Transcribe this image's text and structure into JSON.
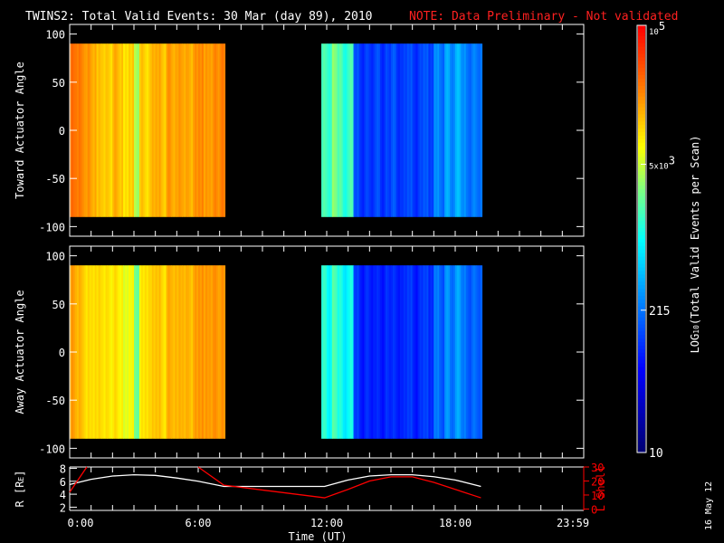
{
  "title": "TWINS2: Total Valid Events: 30 Mar (day  89), 2010",
  "note": "NOTE: Data Preliminary - Not validated",
  "colors": {
    "note": "#ff2020",
    "lshell": "#ff0000",
    "radius": "#ffffff"
  },
  "side_date": "16 May 12",
  "chart_data": [
    {
      "type": "heatmap",
      "title": "Toward Actuator Angle",
      "ylabel": "Toward Actuator Angle",
      "ylim": [
        -110,
        110
      ],
      "yticks": [
        "100",
        "50",
        "0",
        "-50",
        "-100"
      ],
      "angle_range": [
        -90,
        90
      ],
      "time_step_h": 0.25,
      "blocks": [
        {
          "start_h": 0,
          "values_log10": [
            4.5,
            4.45,
            4.35,
            4.3,
            4.2,
            4.15,
            4.1,
            4.05,
            4.2,
            4.1,
            4.0,
            4.1,
            3.6,
            4.1,
            4.0,
            4.2,
            4.25,
            4.1,
            4.3,
            4.2,
            4.3,
            4.25,
            4.2,
            4.3,
            4.35,
            4.3,
            4.3,
            4.35,
            4.4
          ]
        },
        {
          "start_h": 11.75,
          "values_log10": [
            3.3,
            3.2,
            3.5,
            3.3,
            3.1,
            3.3,
            2.2,
            2.0,
            2.1,
            2.0,
            2.2,
            2.0,
            2.1,
            2.2,
            2.0,
            2.1,
            2.2,
            2.0,
            2.1,
            2.2,
            2.1,
            2.5,
            2.3,
            2.6,
            2.4,
            2.7,
            2.5,
            2.3,
            2.4,
            2.3
          ]
        }
      ]
    },
    {
      "type": "heatmap",
      "title": "Away Actuator Angle",
      "ylabel": "Away Actuator Angle",
      "ylim": [
        -110,
        110
      ],
      "yticks": [
        "100",
        "50",
        "0",
        "-50",
        "-100"
      ],
      "angle_range": [
        -90,
        90
      ],
      "time_step_h": 0.25,
      "blocks": [
        {
          "start_h": 0,
          "values_log10": [
            4.3,
            4.2,
            4.1,
            4.0,
            4.0,
            4.05,
            4.0,
            3.95,
            4.0,
            3.9,
            3.8,
            3.9,
            3.4,
            3.95,
            4.0,
            4.1,
            4.15,
            4.0,
            4.2,
            4.15,
            4.2,
            4.2,
            4.15,
            4.25,
            4.3,
            4.3,
            4.3,
            4.3,
            4.3
          ]
        },
        {
          "start_h": 11.75,
          "values_log10": [
            3.2,
            3.0,
            3.3,
            3.1,
            2.9,
            3.1,
            2.1,
            1.9,
            2.0,
            1.9,
            2.0,
            1.9,
            2.0,
            2.0,
            1.9,
            2.0,
            2.1,
            1.9,
            2.0,
            2.1,
            2.0,
            2.4,
            2.2,
            2.5,
            2.3,
            2.6,
            2.4,
            2.2,
            2.3,
            2.2
          ]
        }
      ]
    },
    {
      "type": "line",
      "xlabel": "Time (UT)",
      "xticks": [
        "0:00",
        "6:00",
        "12:00",
        "18:00",
        "23:59"
      ],
      "xlim": [
        0,
        24
      ],
      "ylabel": "R [R_E]",
      "ylabel_parts": {
        "main": "R [R",
        "sub": "E",
        "end": "]"
      },
      "ylim": [
        1.5,
        8.2
      ],
      "yticks": [
        "8",
        "6",
        "4",
        "2"
      ],
      "y2label": "L Shell",
      "y2lim": [
        -1,
        30
      ],
      "y2ticks": [
        "30",
        "20",
        "10",
        "0"
      ],
      "series": [
        {
          "name": "R",
          "color": "#ffffff",
          "x": [
            0,
            1,
            2,
            3,
            4,
            5,
            6,
            7.2,
            11.9,
            13,
            14,
            15,
            16,
            17,
            18,
            19.2
          ],
          "y": [
            5.5,
            6.3,
            6.8,
            7.0,
            6.9,
            6.5,
            6.0,
            5.2,
            5.2,
            6.2,
            6.8,
            7.0,
            7.0,
            6.7,
            6.2,
            5.2
          ]
        },
        {
          "name": "L Shell",
          "color": "#ff0000",
          "segments": [
            {
              "x": [
                0,
                0.8
              ],
              "y": [
                12,
                30
              ]
            },
            {
              "x": [
                6,
                7.2,
                11.9,
                13,
                14,
                15,
                16,
                17,
                18,
                19.2
              ],
              "y": [
                30,
                17,
                8,
                14,
                20,
                23,
                23,
                19,
                14,
                8
              ]
            }
          ]
        }
      ]
    },
    {
      "type": "colorbar",
      "label": "LOG10(Total Valid Events per Scan)",
      "label_parts": {
        "pre": "LOG",
        "sub": "10",
        "post": "(Total Valid Events per Scan)"
      },
      "range_log10": [
        1,
        5
      ],
      "ticks": [
        {
          "value": 100000,
          "label_base": "10",
          "label_exp": "5"
        },
        {
          "value": 5000,
          "label_base": "5x10",
          "label_exp": "3"
        },
        {
          "value": 215,
          "label": "215"
        },
        {
          "value": 10,
          "label": "10"
        }
      ]
    }
  ]
}
